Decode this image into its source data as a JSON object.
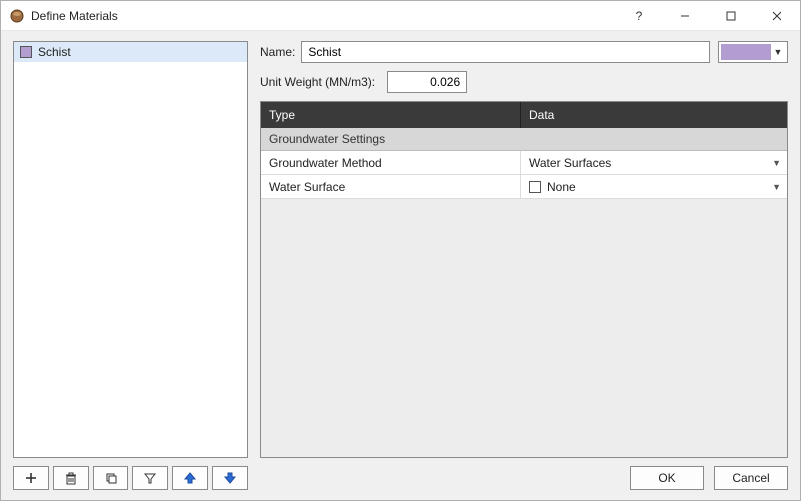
{
  "window": {
    "title": "Define Materials"
  },
  "materials": {
    "items": [
      {
        "name": "Schist",
        "swatch": "#b39cd0"
      }
    ],
    "selected_index": 0
  },
  "form": {
    "name_label": "Name:",
    "name_value": "Schist",
    "color_value": "#b39cd0",
    "unit_weight_label": "Unit Weight (MN/m3):",
    "unit_weight_value": "0.026"
  },
  "grid": {
    "header_type": "Type",
    "header_data": "Data",
    "group_label": "Groundwater Settings",
    "rows": [
      {
        "key": "Groundwater Method",
        "value": "Water Surfaces"
      },
      {
        "key": "Water Surface",
        "value": "None",
        "checkbox": false
      }
    ]
  },
  "buttons": {
    "ok": "OK",
    "cancel": "Cancel"
  }
}
